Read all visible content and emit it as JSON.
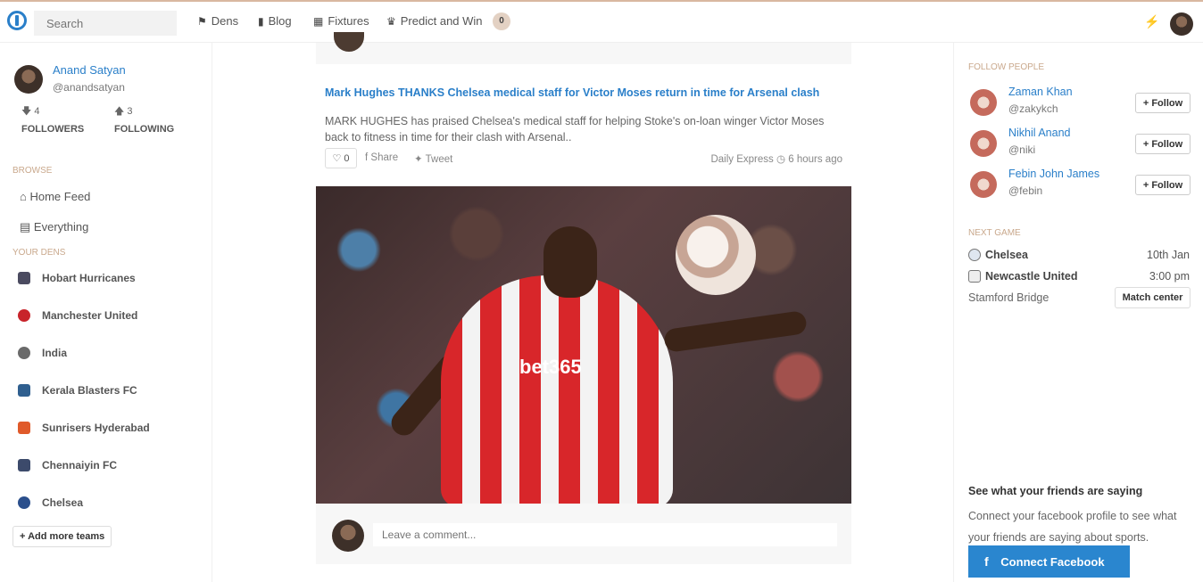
{
  "topbar": {
    "search_placeholder": "Search",
    "nav": [
      {
        "icon": "flag-icon",
        "label": "Dens"
      },
      {
        "icon": "book-icon",
        "label": "Blog"
      },
      {
        "icon": "calendar-icon",
        "label": "Fixtures"
      },
      {
        "icon": "trophy-icon",
        "label": "Predict and Win"
      }
    ],
    "predict_badge": "0"
  },
  "profile": {
    "name": "Anand Satyan",
    "handle": "@anandsatyan",
    "followers_count": "4",
    "followers_label": "FOLLOWERS",
    "following_count": "3",
    "following_label": "FOLLOWING"
  },
  "browse": {
    "heading": "BROWSE",
    "items": [
      "Home Feed",
      "Everything"
    ]
  },
  "dens": {
    "heading": "YOUR DENS",
    "items": [
      "Hobart Hurricanes",
      "Manchester United",
      "India",
      "Kerala Blasters FC",
      "Sunrisers Hyderabad",
      "Chennaiyin FC",
      "Chelsea"
    ],
    "add_label": "Add more teams"
  },
  "post": {
    "title": "Mark Hughes THANKS Chelsea medical staff for Victor Moses return in time for Arsenal clash",
    "body": "MARK HUGHES has praised Chelsea's medical staff for helping Stoke's on-loan winger Victor Moses back to fitness in time for their clash with Arsenal..",
    "likes": "0",
    "share_label": "Share",
    "tweet_label": "Tweet",
    "source": "Daily Express",
    "time": "6 hours ago",
    "image_text": "bet365",
    "comment_placeholder": "Leave a comment..."
  },
  "follow_people": {
    "heading": "FOLLOW PEOPLE",
    "button_label": "Follow",
    "people": [
      {
        "name": "Zaman Khan",
        "handle": "@zakykch"
      },
      {
        "name": "Nikhil Anand",
        "handle": "@niki"
      },
      {
        "name": "Febin John James",
        "handle": "@febin"
      }
    ]
  },
  "next_game": {
    "heading": "NEXT GAME",
    "home": "Chelsea",
    "away": "Newcastle United",
    "date": "10th Jan",
    "time": "3:00 pm",
    "venue": "Stamford Bridge",
    "match_center_label": "Match center"
  },
  "friends": {
    "heading": "See what your friends are saying",
    "text": "Connect your facebook profile to see what your friends are saying about sports.",
    "button_label": "Connect Facebook"
  }
}
